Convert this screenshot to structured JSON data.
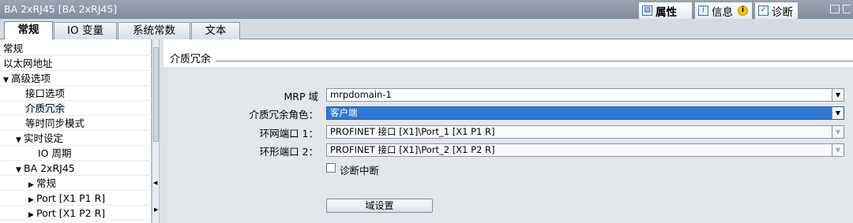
{
  "window": {
    "title": "BA 2xRJ45 [BA 2xRJ45]"
  },
  "panel_tabs": [
    {
      "label": "属性",
      "icon": "properties-icon"
    },
    {
      "label": "信息",
      "icon": "info-icon"
    },
    {
      "label": "诊断",
      "icon": "diagnostics-icon"
    }
  ],
  "sub_tabs": [
    "常规",
    "IO 变量",
    "系统常数",
    "文本"
  ],
  "tree": [
    {
      "label": "常规",
      "arrow": ""
    },
    {
      "label": "以太网地址",
      "arrow": ""
    },
    {
      "label": "高级选项",
      "arrow": "▼"
    },
    {
      "label": "接口选项",
      "arrow": ""
    },
    {
      "label": "介质冗余",
      "arrow": ""
    },
    {
      "label": "等时同步模式",
      "arrow": ""
    },
    {
      "label": "实时设定",
      "arrow": "▼"
    },
    {
      "label": "IO 周期",
      "arrow": ""
    },
    {
      "label": "BA 2xRJ45",
      "arrow": "▼"
    },
    {
      "label": "常规",
      "arrow": "▶"
    },
    {
      "label": "Port [X1 P1 R]",
      "arrow": "▶"
    },
    {
      "label": "Port [X1 P2 R]",
      "arrow": "▶"
    }
  ],
  "section": {
    "title": "介质冗余"
  },
  "form": {
    "mrp_domain": {
      "label": "MRP 域",
      "value": "mrpdomain-1"
    },
    "role": {
      "label": "介质冗余角色：",
      "value": "客户端"
    },
    "ring_port1": {
      "label": "环网端口 1：",
      "value": "PROFINET 接口 [X1]\\Port_1 [X1 P1 R]"
    },
    "ring_port2": {
      "label": "环形端口 2：",
      "value": "PROFINET 接口 [X1]\\Port_2 [X1 P2 R]"
    },
    "diag_interrupt": {
      "label": "诊断中断",
      "checked": false
    },
    "domain_settings_button": "域设置"
  }
}
